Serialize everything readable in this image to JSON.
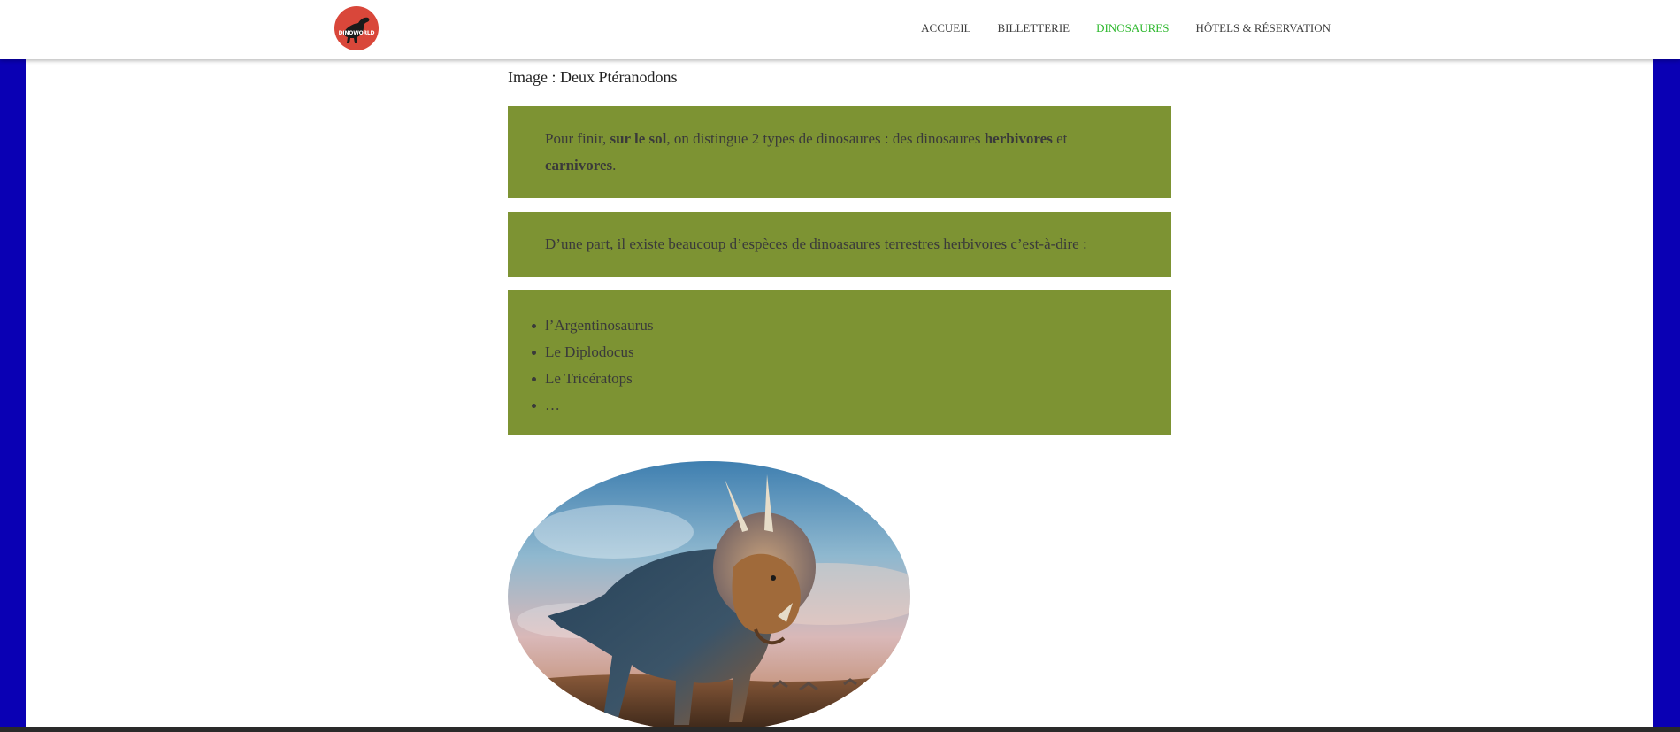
{
  "header": {
    "logo_text": "DINOWORLD",
    "nav": [
      {
        "label": "ACCUEIL",
        "active": false
      },
      {
        "label": "BILLETTERIE",
        "active": false
      },
      {
        "label": "DINOSAURES",
        "active": true
      },
      {
        "label": "HÔTELS & RÉSERVATION",
        "active": false
      }
    ]
  },
  "content": {
    "caption": "Image : Deux Ptéranodons",
    "box1": {
      "t1": "Pour finir, ",
      "b1": "sur le sol",
      "t2": ", on distingue 2 types de dinosaures : des dinosaures ",
      "b2": "herbivores",
      "t3": " et ",
      "b3": "carnivores",
      "t4": "."
    },
    "box2": {
      "text": "D’une part, il existe beaucoup d’espèces de dinoasaures terrestres herbivores c’est-à-dire :"
    },
    "list": [
      "l’Argentinosaurus",
      "Le Diplodocus",
      "Le Tricératops",
      "…"
    ],
    "image": {
      "subject": "triceratops-illustration"
    }
  },
  "colors": {
    "side_background": "#0a00b4",
    "box_background": "#7d9333",
    "nav_active": "#2eb82e",
    "logo_circle": "#d9473a"
  }
}
